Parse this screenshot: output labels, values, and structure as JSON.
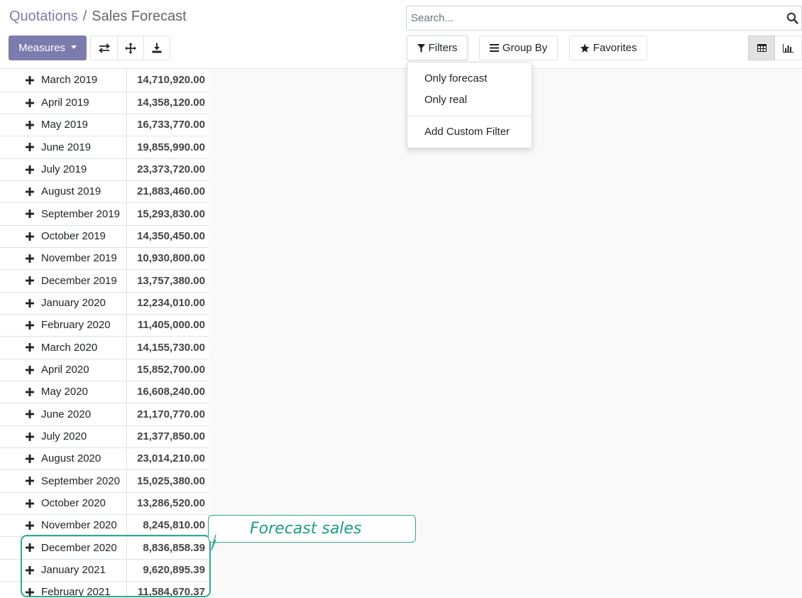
{
  "breadcrumb": {
    "parent": "Quotations",
    "separator": "/",
    "current": "Sales Forecast"
  },
  "search": {
    "placeholder": "Search..."
  },
  "toolbar": {
    "measures_label": "Measures",
    "filters_label": "Filters",
    "group_by_label": "Group By",
    "favorites_label": "Favorites"
  },
  "filters_menu": {
    "items": [
      "Only forecast",
      "Only real"
    ],
    "custom_filter_label": "Add Custom Filter"
  },
  "pivot": {
    "rows": [
      {
        "label": "March 2019",
        "value": "14,710,920.00"
      },
      {
        "label": "April 2019",
        "value": "14,358,120.00"
      },
      {
        "label": "May 2019",
        "value": "16,733,770.00"
      },
      {
        "label": "June 2019",
        "value": "19,855,990.00"
      },
      {
        "label": "July 2019",
        "value": "23,373,720.00"
      },
      {
        "label": "August 2019",
        "value": "21,883,460.00"
      },
      {
        "label": "September 2019",
        "value": "15,293,830.00"
      },
      {
        "label": "October 2019",
        "value": "14,350,450.00"
      },
      {
        "label": "November 2019",
        "value": "10,930,800.00"
      },
      {
        "label": "December 2019",
        "value": "13,757,380.00"
      },
      {
        "label": "January 2020",
        "value": "12,234,010.00"
      },
      {
        "label": "February 2020",
        "value": "11,405,000.00"
      },
      {
        "label": "March 2020",
        "value": "14,155,730.00"
      },
      {
        "label": "April 2020",
        "value": "15,852,700.00"
      },
      {
        "label": "May 2020",
        "value": "16,608,240.00"
      },
      {
        "label": "June 2020",
        "value": "21,170,770.00"
      },
      {
        "label": "July 2020",
        "value": "21,377,850.00"
      },
      {
        "label": "August 2020",
        "value": "23,014,210.00"
      },
      {
        "label": "September 2020",
        "value": "15,025,380.00"
      },
      {
        "label": "October 2020",
        "value": "13,286,520.00"
      },
      {
        "label": "November 2020",
        "value": "8,245,810.00"
      },
      {
        "label": "December 2020",
        "value": "8,836,858.39"
      },
      {
        "label": "January 2021",
        "value": "9,620,895.39"
      },
      {
        "label": "February 2021",
        "value": "11,584,670.37"
      }
    ]
  },
  "annotation": {
    "callout_text": "Forecast sales"
  },
  "colors": {
    "brand": "#7c7bad",
    "annotation": "#2faa8a"
  },
  "icons": [
    "search-icon",
    "caret-down-icon",
    "flip-axis-icon",
    "expand-all-icon",
    "download-icon",
    "filter-icon",
    "bars-icon",
    "star-icon",
    "table-view-icon",
    "bar-chart-view-icon",
    "plus-icon"
  ]
}
